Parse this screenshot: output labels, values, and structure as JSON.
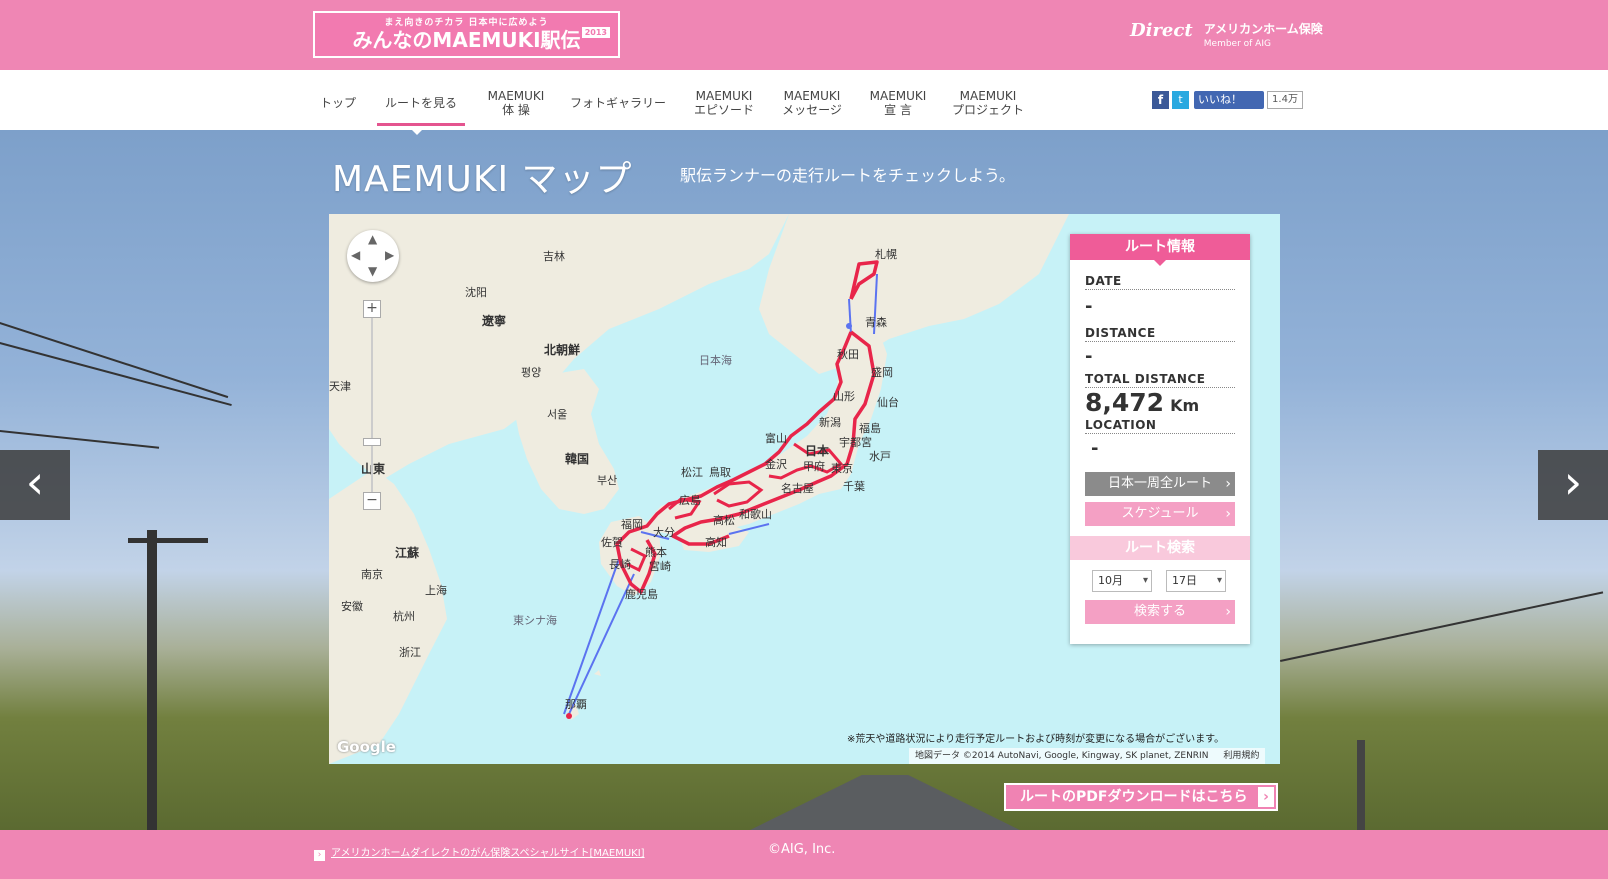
{
  "header": {
    "logo_tagline": "まえ向きのチカラ 日本中に広めよう",
    "logo_title": "みんなのMAEMUKI駅伝",
    "logo_year": "2013",
    "brand_direct": "Direct",
    "brand_name": "アメリカンホーム保険",
    "brand_member": "Member of AIG"
  },
  "nav": {
    "items": [
      {
        "label": "トップ"
      },
      {
        "label": "ルートを見る"
      },
      {
        "label": "MAEMUKI\n体 操"
      },
      {
        "label": "フォトギャラリー"
      },
      {
        "label": "MAEMUKI\nエピソード"
      },
      {
        "label": "MAEMUKI\nメッセージ"
      },
      {
        "label": "MAEMUKI\n宣 言"
      },
      {
        "label": "MAEMUKI\nプロジェクト"
      }
    ],
    "active_index": 1
  },
  "social": {
    "like_label": "いいね！",
    "like_count": "1.4万"
  },
  "page": {
    "title": "MAEMUKI マップ",
    "subtitle": "駅伝ランナーの走行ルートをチェックしよう。"
  },
  "map": {
    "labels": {
      "jilin": "吉林",
      "shenyang": "沈阳",
      "liaoning": "遼寧",
      "tianjin": "天津",
      "north_korea": "北朝鮮",
      "pyongyang": "평양",
      "seoul": "서울",
      "south_korea": "韓国",
      "busan": "부산",
      "shandong": "山東",
      "jiangsu": "江蘇",
      "nanjing": "南京",
      "shanghai": "上海",
      "anhui": "安徽",
      "hangzhou": "杭州",
      "zhejiang": "浙江",
      "sea_of_japan": "日本海",
      "east_china_sea": "東シナ海",
      "sapporo": "札幌",
      "aomori": "青森",
      "akita": "秋田",
      "morioka": "盛岡",
      "yamagata": "山形",
      "sendai": "仙台",
      "niigata": "新潟",
      "fukushima": "福島",
      "utsunomiya": "宇都宮",
      "mito": "水戸",
      "toyama": "富山",
      "japan": "日本",
      "kanazawa": "金沢",
      "kofu": "甲府",
      "tokyo": "東京",
      "chiba": "千葉",
      "nagoya": "名古屋",
      "matsue": "松江",
      "tottori": "鳥取",
      "hiroshima": "広島",
      "takamatsu": "高松",
      "wakayama": "和歌山",
      "kochi": "高知",
      "fukuoka": "福岡",
      "oita": "大分",
      "saga": "佐賀",
      "kumamoto": "熊本",
      "nagasaki": "長崎",
      "miyazaki": "宮崎",
      "kagoshima": "鹿児島",
      "naha": "那覇"
    },
    "note": "※荒天や道路状況により走行予定ルートおよび時刻が変更になる場合がございます。",
    "credit": "地図データ ©2014 AutoNavi, Google, Kingway, SK planet, ZENRIN",
    "terms": "利用規約",
    "google": "Google",
    "route_color": "#e8254a",
    "ferry_color": "#5b73f0",
    "land_color": "#efece0",
    "sea_color": "#c7f2f7"
  },
  "info_panel": {
    "title": "ルート情報",
    "date_label": "DATE",
    "date_value": "-",
    "distance_label": "DISTANCE",
    "distance_value": "-",
    "total_label": "TOTAL DISTANCE",
    "total_value": "8,472",
    "total_unit": "Km",
    "location_label": "LOCATION",
    "location_value": "-",
    "btn_full_route": "日本一周全ルート",
    "btn_schedule": "スケジュール",
    "search_title": "ルート検索",
    "month_value": "10月",
    "day_value": "17日",
    "btn_search": "検索する"
  },
  "pdf_button": "ルートのPDFダウンロードはこちら",
  "footer": {
    "link": "アメリカンホームダイレクトのがん保険スペシャルサイト[MAEMUKI]",
    "copyright": "©AIG, Inc."
  }
}
